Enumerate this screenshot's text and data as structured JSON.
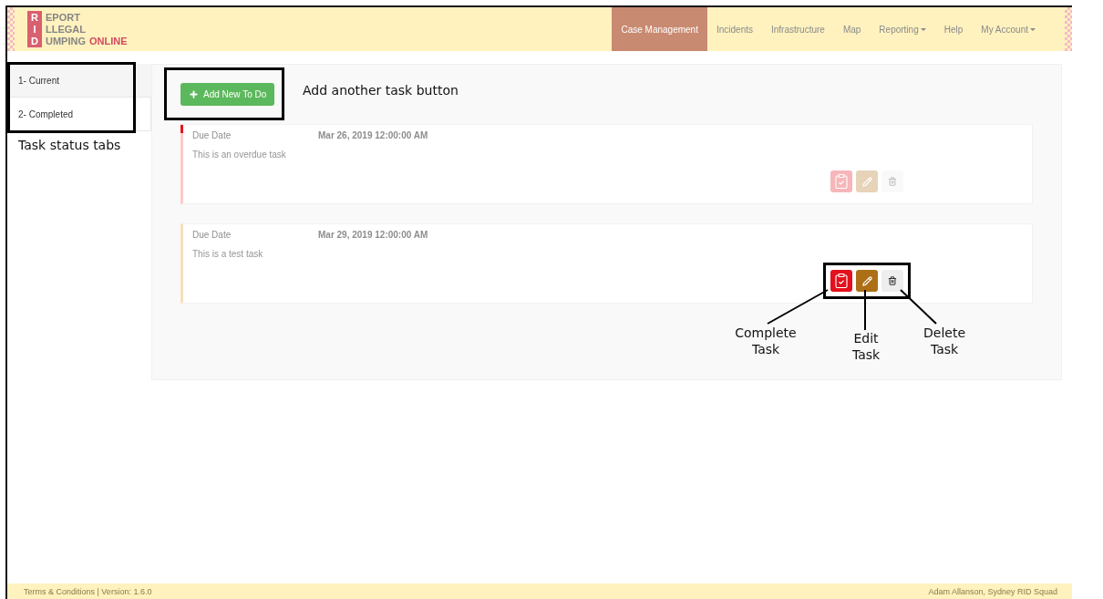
{
  "header": {
    "logo": {
      "letters": [
        "R",
        "I",
        "D"
      ],
      "words": [
        "EPORT",
        "LLEGAL",
        "UMPING"
      ],
      "suffix": "ONLINE"
    },
    "nav": [
      {
        "label": "Case Management",
        "selected": true,
        "dropdown": false
      },
      {
        "label": "Incidents",
        "selected": false,
        "dropdown": false
      },
      {
        "label": "Infrastructure",
        "selected": false,
        "dropdown": false
      },
      {
        "label": "Map",
        "selected": false,
        "dropdown": false
      },
      {
        "label": "Reporting",
        "selected": false,
        "dropdown": true
      },
      {
        "label": "Help",
        "selected": false,
        "dropdown": false
      },
      {
        "label": "My Account",
        "selected": false,
        "dropdown": true
      }
    ]
  },
  "tabs": [
    {
      "label": "1- Current",
      "selected": true
    },
    {
      "label": "2- Completed",
      "selected": false
    }
  ],
  "add_button": {
    "label": "Add New To Do"
  },
  "tasks": [
    {
      "due_label": "Due Date",
      "due_date": "Mar 26, 2019 12:00:00 AM",
      "description": "This is an overdue task",
      "overdue": true,
      "dimmed": true
    },
    {
      "due_label": "Due Date",
      "due_date": "Mar 29, 2019 12:00:00 AM",
      "description": "This is a test task",
      "overdue": false,
      "dimmed": false
    }
  ],
  "annotations": {
    "tabs_label": "Task status tabs",
    "add_button_label": "Add another task button",
    "action_labels": [
      "Complete Task",
      "Edit Task",
      "Delete Task"
    ]
  },
  "footer": {
    "left": "Terms & Conditions | Version: 1.6.0",
    "right": "Adam Allanson, Sydney RID Squad"
  }
}
